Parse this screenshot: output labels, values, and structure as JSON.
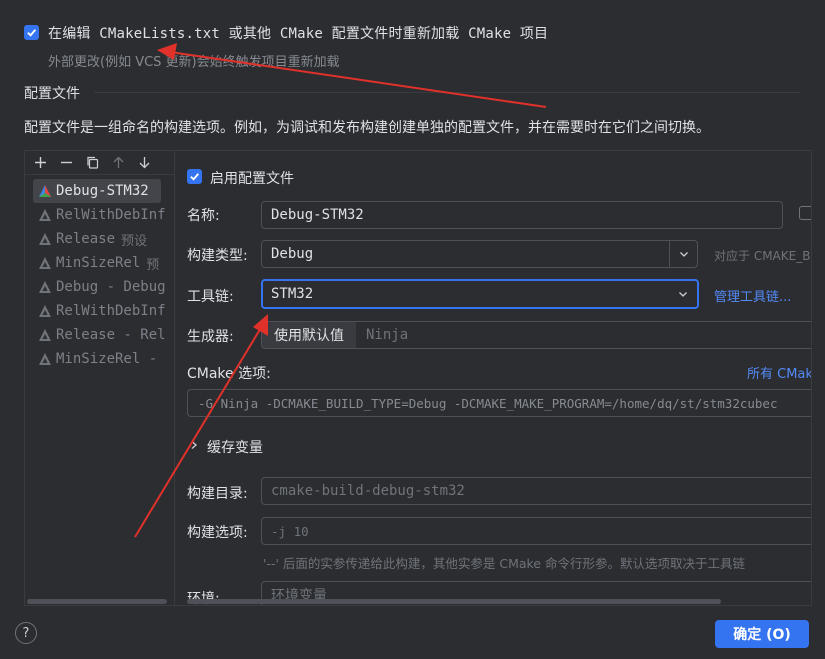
{
  "reload": {
    "checked": true,
    "label": "在编辑 CMakeLists.txt 或其他 CMake 配置文件时重新加载 CMake 项目",
    "hint": "外部更改(例如 VCS 更新)会始终触发项目重新加载"
  },
  "profiles": {
    "title": "配置文件",
    "description": "配置文件是一组命名的构建选项。例如，为调试和发布构建创建单独的配置文件，并在需要时在它们之间切换。"
  },
  "toolbar": {
    "add_icon": "plus-icon",
    "remove_icon": "minus-icon",
    "copy_icon": "copy-icon",
    "up_icon": "arrow-up-icon",
    "down_icon": "arrow-down-icon"
  },
  "profile_list": [
    {
      "name": "Debug-STM32",
      "hint": "",
      "selected": true
    },
    {
      "name": "RelWithDebInf",
      "hint": ""
    },
    {
      "name": "Release",
      "hint": "预设"
    },
    {
      "name": "MinSizeRel",
      "hint": "预"
    },
    {
      "name": "Debug - Debug",
      "hint": ""
    },
    {
      "name": "RelWithDebInf",
      "hint": ""
    },
    {
      "name": "Release - Rel",
      "hint": ""
    },
    {
      "name": "MinSizeRel -",
      "hint": ""
    }
  ],
  "details": {
    "enable_label": "启用配置文件",
    "enable_checked": true,
    "name_label": "名称:",
    "name_value": "Debug-STM32",
    "build_type_label": "构建类型:",
    "build_type_value": "Debug",
    "build_type_hint": "对应于 CMAKE_B",
    "toolchain_label": "工具链:",
    "toolchain_value": "STM32",
    "toolchain_link": "管理工具链...",
    "generator_label": "生成器:",
    "generator_default": "使用默认值",
    "generator_value": "Ninja",
    "cmake_options_label": "CMake 选项:",
    "cmake_options_link": "所有 CMak",
    "cmake_options_value": "-G Ninja -DCMAKE_BUILD_TYPE=Debug -DCMAKE_MAKE_PROGRAM=/home/dq/st/stm32cubec",
    "cache_vars_label": "缓存变量",
    "build_dir_label": "构建目录:",
    "build_dir_value": "cmake-build-debug-stm32",
    "build_opts_label": "构建选项:",
    "build_opts_value": "-j 10",
    "build_opts_hint": "'--' 后面的实参传递给此构建，其他实参是 CMake 命令行形参。默认选项取决于工具链",
    "env_label": "环境:",
    "env_placeholder": "环境变量"
  },
  "buttons": {
    "help": "?",
    "ok": "确定 (O)"
  },
  "colors": {
    "accent": "#3574f0",
    "annotation": "#e0312b"
  }
}
